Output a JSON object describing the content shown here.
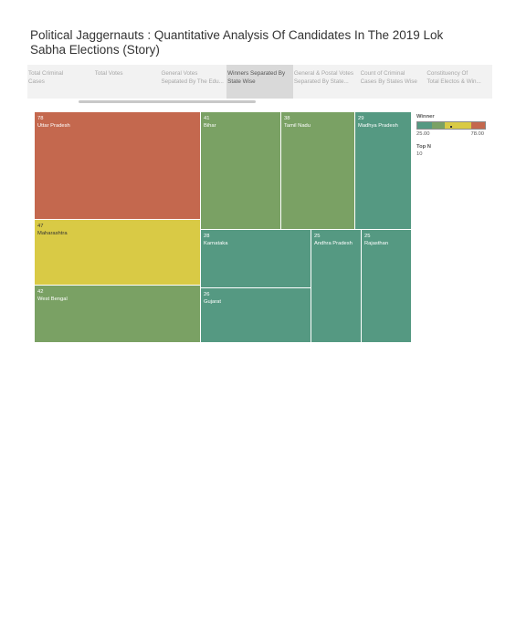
{
  "title": "Political Jaggernauts : Quantitative Analysis Of Candidates In The 2019 Lok Sabha Elections (Story)",
  "tabs": [
    {
      "line1": "Total Criminal",
      "line2": "Cases",
      "active": false
    },
    {
      "line1": "Total Votes",
      "line2": "",
      "active": false
    },
    {
      "line1": "General Votes",
      "line2": "Sepatated By The Edu...",
      "active": false
    },
    {
      "line1": "Winners Separated By",
      "line2": "State Wise",
      "active": true
    },
    {
      "line1": "General & Postal Votes",
      "line2": "Separated By State...",
      "active": false
    },
    {
      "line1": "Count of Criminal",
      "line2": "Cases By States Wise",
      "active": false
    },
    {
      "line1": "Constituency Of",
      "line2": "Total Electos & Win...",
      "active": false
    }
  ],
  "colors": {
    "high": "#c4684e",
    "mid": "#d9ca45",
    "green": "#7aa164",
    "teal": "#559982"
  },
  "treemap": [
    {
      "state": "Uttar Pradesh",
      "value": "78",
      "color": "#c4684e"
    },
    {
      "state": "Maharashtra",
      "value": "47",
      "color": "#d9ca45"
    },
    {
      "state": "West Bengal",
      "value": "42",
      "color": "#7aa164"
    },
    {
      "state": "Bihar",
      "value": "41",
      "color": "#7aa164"
    },
    {
      "state": "Tamil Nadu",
      "value": "38",
      "color": "#7aa164"
    },
    {
      "state": "Madhya Pradesh",
      "value": "29",
      "color": "#559982"
    },
    {
      "state": "Karnataka",
      "value": "28",
      "color": "#559982"
    },
    {
      "state": "Gujarat",
      "value": "26",
      "color": "#559982"
    },
    {
      "state": "Andhra Pradesh",
      "value": "25",
      "color": "#559982"
    },
    {
      "state": "Rajasthan",
      "value": "25",
      "color": "#559982"
    }
  ],
  "legend": {
    "title": "Winner",
    "min": "25.00",
    "max": "78.00",
    "topn_label": "Top N",
    "topn_value": "10"
  }
}
